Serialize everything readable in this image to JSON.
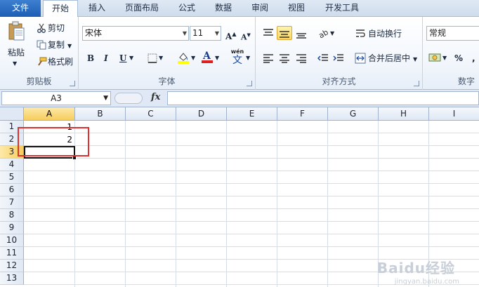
{
  "tabs": {
    "file": "文件",
    "home": "开始",
    "insert": "插入",
    "page_layout": "页面布局",
    "formulas": "公式",
    "data": "数据",
    "review": "审阅",
    "view": "视图",
    "developer": "开发工具"
  },
  "clipboard": {
    "paste": "粘贴",
    "cut": "剪切",
    "copy": "复制",
    "format_painter": "格式刷",
    "label": "剪贴板"
  },
  "font": {
    "name": "宋体",
    "size": "11",
    "bold": "B",
    "italic": "I",
    "underline": "U",
    "label": "字体",
    "phonetic": "wén",
    "phonetic_char": "文"
  },
  "alignment": {
    "wrap_text": "自动换行",
    "merge_center": "合并后居中",
    "label": "对齐方式"
  },
  "number": {
    "format": "常规",
    "percent": "%",
    "label": "数字"
  },
  "formula_bar": {
    "name_box": "A3",
    "fx": "fx"
  },
  "sheet": {
    "columns": [
      "A",
      "B",
      "C",
      "D",
      "E",
      "F",
      "G",
      "H",
      "I"
    ],
    "rows": [
      "1",
      "2",
      "3",
      "4",
      "5",
      "6",
      "7",
      "8",
      "9",
      "10",
      "11",
      "12",
      "13"
    ],
    "cells": {
      "A1": "1",
      "A2": "2"
    },
    "active_cell": "A3"
  },
  "watermark": {
    "main": "Baidu经验",
    "sub": "jingyan.baidu.com"
  }
}
